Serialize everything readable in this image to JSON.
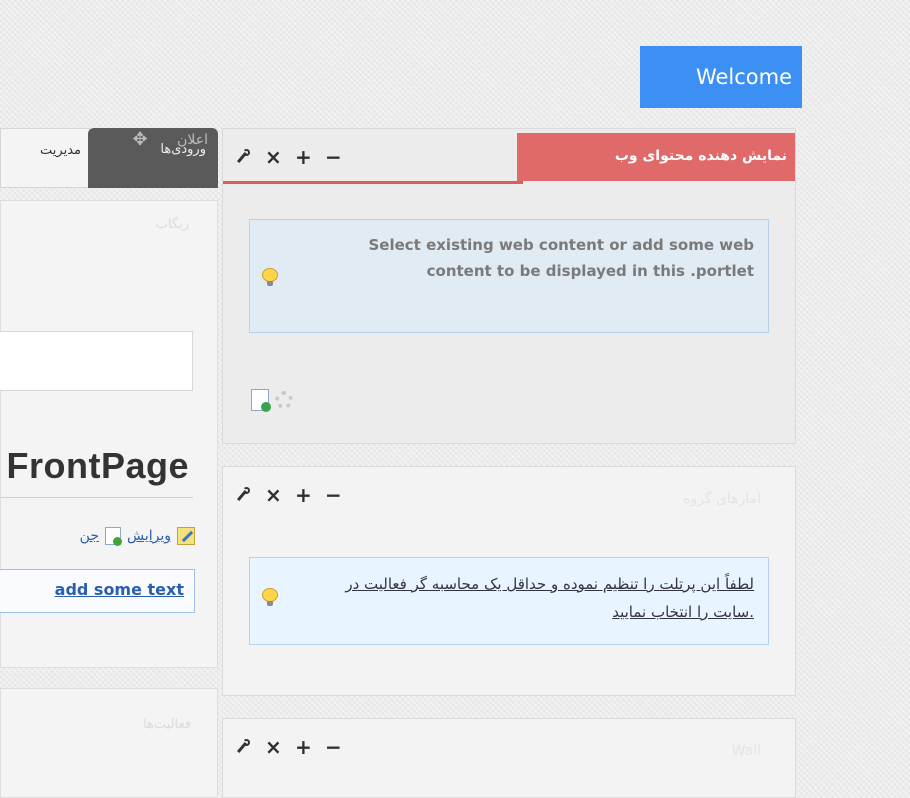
{
  "header": {
    "welcome_label": "Welcome"
  },
  "left_tabs": {
    "manage_label": "مدیریت",
    "entries_label": "ورودی‌ها",
    "entries_ghost_label": "اعلان"
  },
  "left_portlet": {
    "title": "ریگاب",
    "heading": "FrontPage",
    "edit_label": "ویرایش",
    "other_label": "جن",
    "add_text_label": "add some text"
  },
  "left_portlet2": {
    "title": "فعالیت‌ها"
  },
  "portlets": [
    {
      "title": "نمایش دهنده محتوای وب",
      "info": "Select existing web content or add some web content to be displayed in this .portlet"
    },
    {
      "title": "آمارهای گروه",
      "info": "لطفاً این پرتلت را تنظیم نموده و حداقل یک محاسبه گر فعالیت در سایت را انتخاب نمایید."
    },
    {
      "title": "Wall"
    }
  ],
  "controls": {
    "wrench": "wrench-icon",
    "close": "×",
    "add": "+",
    "minimize": "−"
  },
  "colors": {
    "welcome": "#3d90f3",
    "portlet_title_red": "#e06a6a",
    "info_bg": "#e1ebf4"
  }
}
